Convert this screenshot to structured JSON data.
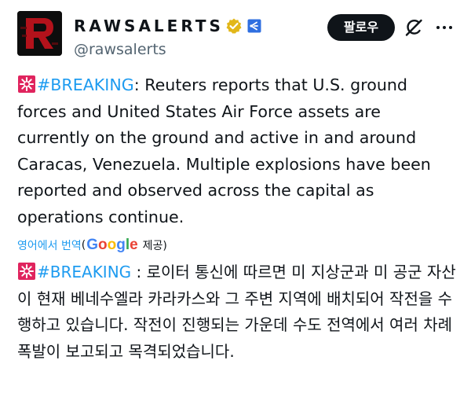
{
  "account": {
    "display_name": "RAWSALERTS",
    "handle": "@rawsalerts",
    "follow_label": "팔로우",
    "avatar_letter": "R"
  },
  "tweet": {
    "hashtag": "#BREAKING",
    "body_after_hashtag": ": Reuters reports that U.S. ground forces and United States Air Force assets are currently on the ground and active in and around Caracas, Venezuela. Multiple explosions have been reported and observed across the capital as operations continue."
  },
  "translation": {
    "link_text": "영어에서 번역",
    "open_paren": "(",
    "google_letters": [
      "G",
      "o",
      "o",
      "g",
      "l",
      "e"
    ],
    "provided_text": "제공)",
    "hashtag": "#BREAKING",
    "body_after_hashtag": " : 로이터 통신에 따르면 미 지상군과 미 공군 자산이 현재 베네수엘라 카라카스와 그 주변 지역에 배치되어 작전을 수행하고 있습니다. 작전이 진행되는 가운데 수도 전역에서 여러 차례 폭발이 보고되고 목격되었습니다."
  },
  "colors": {
    "link_blue": "#1d9bf0",
    "text": "#0f1419",
    "secondary": "#536471",
    "verified_gold": "#e2b719",
    "siren_red": "#e0245e",
    "google": [
      "#4285f4",
      "#ea4335",
      "#fbbc05",
      "#4285f4",
      "#34a853",
      "#ea4335"
    ]
  },
  "icons": {
    "verified": "verified-gold-badge-icon",
    "affiliate": "affiliate-badge-icon",
    "grok": "grok-icon",
    "more": "more-dots-icon",
    "siren": "rotating-light-emoji-icon"
  }
}
